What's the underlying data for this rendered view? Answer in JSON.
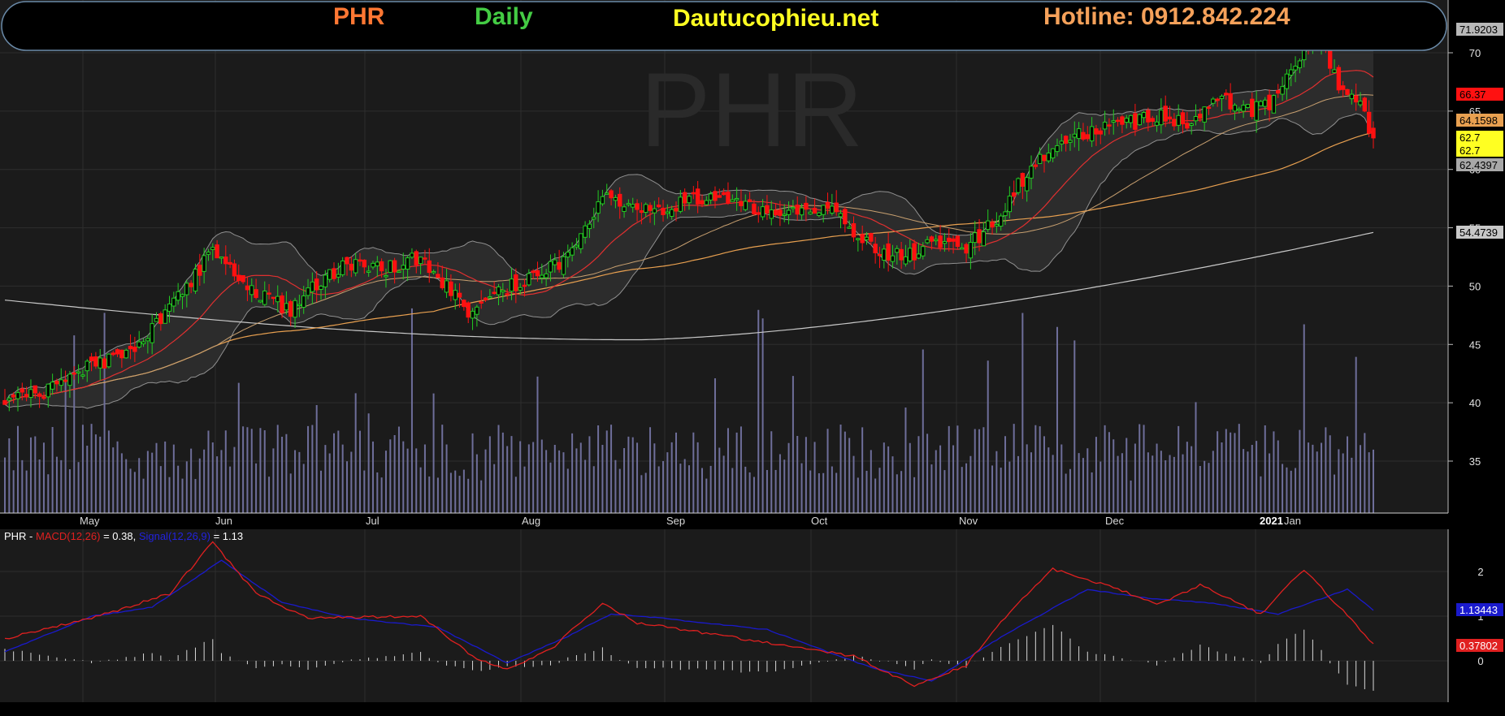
{
  "header": {
    "symbol": "PHR",
    "period": "Daily",
    "website": "Dautucophieu.net",
    "hotline": "Hotline: 0912.842.224",
    "watermark": "PHR"
  },
  "colors": {
    "symbol": "#ff7733",
    "period": "#44cc44",
    "website": "#ffff22",
    "hotline": "#f5a15a",
    "up_candle": "#22cc22",
    "down_candle": "#ff1111",
    "ma_short": "#e03030",
    "ma_mid": "#e8a050",
    "ma_long": "#c8c8c8",
    "bollinger": "#909090",
    "volume": "#6e6e9a",
    "macd": "#e02020",
    "signal": "#1a1acc",
    "histogram": "#d8d8d8"
  },
  "macd_legend": {
    "prefix": "PHR - ",
    "macd_label": "MACD(12,26)",
    "macd_value": " = 0.38, ",
    "signal_label": "Signal(12,26,9)",
    "signal_value": " = 1.13"
  },
  "price_axis": {
    "ticks": [
      "70",
      "65",
      "60",
      "55",
      "50",
      "45",
      "40",
      "35"
    ],
    "tags": [
      {
        "text": "71.9203",
        "bg": "#b8b8b8",
        "fg": "#000"
      },
      {
        "text": "66.37",
        "bg": "#ff1111",
        "fg": "#000"
      },
      {
        "text": "64.1598",
        "bg": "#e8a050",
        "fg": "#000"
      },
      {
        "text": "62.7",
        "bg": "#ffff22",
        "fg": "#000"
      },
      {
        "text": "62.7",
        "bg": "#ffff22",
        "fg": "#000"
      },
      {
        "text": "62.4397",
        "bg": "#a8a8a8",
        "fg": "#000"
      },
      {
        "text": "54.4739",
        "bg": "#c8c8c8",
        "fg": "#000"
      }
    ]
  },
  "macd_axis": {
    "ticks": [
      "2",
      "1",
      "0"
    ],
    "tags": [
      {
        "text": "1.13443",
        "bg": "#1a1acc",
        "fg": "#fff"
      },
      {
        "text": "0.37802",
        "bg": "#e02020",
        "fg": "#fff"
      }
    ]
  },
  "time_axis": {
    "labels": [
      "May",
      "Jun",
      "Jul",
      "Aug",
      "Sep",
      "Oct",
      "Nov",
      "Dec",
      "2021",
      "Jan"
    ]
  },
  "chart_data": [
    {
      "type": "candlestick",
      "title": "PHR Daily",
      "ylim": [
        31,
        73
      ],
      "grid": true,
      "series": [
        {
          "name": "PHR",
          "anchors_close": [
            [
              0,
              40.3
            ],
            [
              10,
              41.0
            ],
            [
              20,
              43.2
            ],
            [
              30,
              44.4
            ],
            [
              38,
              48.0
            ],
            [
              48,
              53.0
            ],
            [
              54,
              51.0
            ],
            [
              60,
              49.0
            ],
            [
              66,
              48.0
            ],
            [
              72,
              50.2
            ],
            [
              80,
              52.0
            ],
            [
              88,
              51.5
            ],
            [
              96,
              52.4
            ],
            [
              104,
              49.2
            ],
            [
              108,
              47.5
            ],
            [
              114,
              49.5
            ],
            [
              122,
              51.0
            ],
            [
              130,
              52.3
            ],
            [
              138,
              57.5
            ],
            [
              146,
              56.8
            ],
            [
              152,
              56.5
            ],
            [
              160,
              57.5
            ],
            [
              168,
              57.2
            ],
            [
              176,
              56.2
            ],
            [
              184,
              56.8
            ],
            [
              192,
              56.3
            ],
            [
              200,
              53.2
            ],
            [
              208,
              52.5
            ],
            [
              214,
              53.6
            ],
            [
              222,
              53.2
            ],
            [
              230,
              56.2
            ],
            [
              236,
              59.8
            ],
            [
              244,
              62.8
            ],
            [
              252,
              63.4
            ],
            [
              258,
              63.8
            ],
            [
              266,
              64.5
            ],
            [
              274,
              64.0
            ],
            [
              280,
              66.2
            ],
            [
              286,
              65.0
            ],
            [
              292,
              65.5
            ],
            [
              298,
              69.5
            ],
            [
              304,
              71.5
            ],
            [
              308,
              67.0
            ],
            [
              312,
              66.3
            ],
            [
              316,
              62.7
            ]
          ]
        },
        {
          "name": "Volume",
          "note": "per-session bars, relative scale"
        }
      ]
    },
    {
      "type": "line",
      "title": "MACD",
      "ylim": [
        -0.9,
        2.6
      ],
      "series": [
        {
          "name": "MACD(12,26)",
          "anchors": [
            [
              0,
              0.5
            ],
            [
              20,
              0.95
            ],
            [
              38,
              1.5
            ],
            [
              48,
              2.65
            ],
            [
              58,
              1.5
            ],
            [
              70,
              0.95
            ],
            [
              96,
              1.0
            ],
            [
              108,
              0.1
            ],
            [
              116,
              -0.2
            ],
            [
              126,
              0.25
            ],
            [
              138,
              1.3
            ],
            [
              146,
              0.85
            ],
            [
              170,
              0.5
            ],
            [
              196,
              0.1
            ],
            [
              210,
              -0.55
            ],
            [
              222,
              -0.1
            ],
            [
              232,
              1.1
            ],
            [
              242,
              2.05
            ],
            [
              256,
              1.65
            ],
            [
              266,
              1.25
            ],
            [
              276,
              1.7
            ],
            [
              290,
              1.05
            ],
            [
              300,
              2.05
            ],
            [
              316,
              0.38
            ]
          ]
        },
        {
          "name": "Signal(12,26,9)",
          "anchors": [
            [
              0,
              0.2
            ],
            [
              20,
              1.0
            ],
            [
              34,
              1.2
            ],
            [
              50,
              2.25
            ],
            [
              64,
              1.3
            ],
            [
              80,
              0.95
            ],
            [
              100,
              0.75
            ],
            [
              116,
              -0.05
            ],
            [
              130,
              0.55
            ],
            [
              140,
              1.05
            ],
            [
              152,
              0.95
            ],
            [
              176,
              0.7
            ],
            [
              200,
              -0.15
            ],
            [
              214,
              -0.45
            ],
            [
              232,
              0.65
            ],
            [
              250,
              1.6
            ],
            [
              264,
              1.4
            ],
            [
              278,
              1.3
            ],
            [
              294,
              1.05
            ],
            [
              310,
              1.6
            ],
            [
              316,
              1.13
            ]
          ]
        }
      ]
    }
  ]
}
